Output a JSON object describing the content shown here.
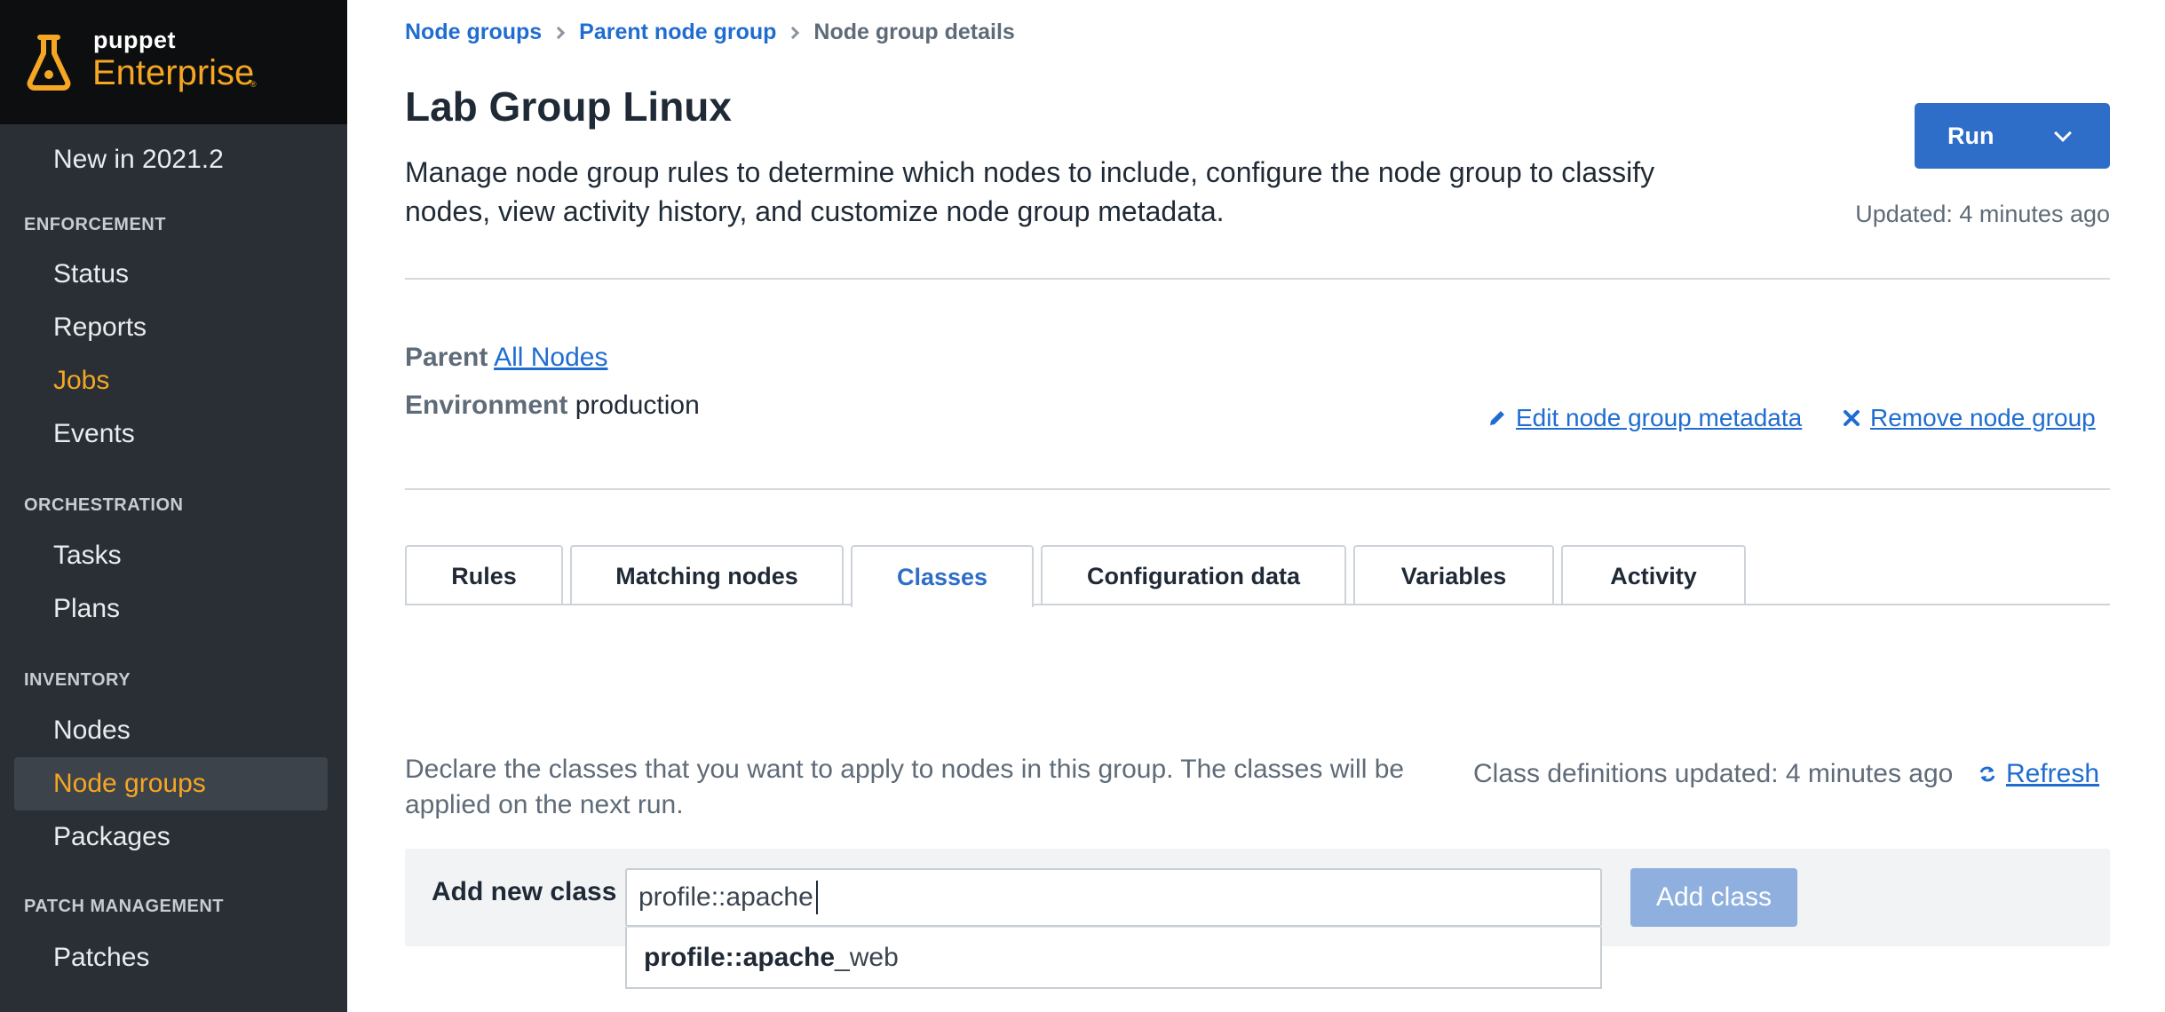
{
  "brand": {
    "small": "puppet",
    "big": "Enterprise",
    "reg": "®",
    "accent": "#f5a623"
  },
  "sidebar": {
    "new_in": "New in 2021.2",
    "sections": {
      "enforcement": "ENFORCEMENT",
      "orchestration": "ORCHESTRATION",
      "inventory": "INVENTORY",
      "patch": "PATCH MANAGEMENT"
    },
    "items": {
      "status": "Status",
      "reports": "Reports",
      "jobs": "Jobs",
      "events": "Events",
      "tasks": "Tasks",
      "plans": "Plans",
      "nodes": "Nodes",
      "node_groups": "Node groups",
      "packages": "Packages",
      "patches": "Patches"
    }
  },
  "breadcrumb": {
    "items": [
      "Node groups",
      "Parent node group"
    ],
    "current": "Node group details"
  },
  "header": {
    "title": "Lab Group Linux",
    "description": "Manage node group rules to determine which nodes to include, configure the node group to classify nodes, view activity history, and customize node group metadata.",
    "run_label": "Run",
    "updated": "Updated: 4 minutes ago"
  },
  "meta": {
    "parent_label": "Parent",
    "parent_value": "All Nodes",
    "environment_label": "Environment",
    "environment_value": "production",
    "edit_link": "Edit node group metadata",
    "remove_link": "Remove node group"
  },
  "tabs": [
    "Rules",
    "Matching nodes",
    "Classes",
    "Configuration data",
    "Variables",
    "Activity"
  ],
  "active_tab": "Classes",
  "classes": {
    "description": "Declare the classes that you want to apply to nodes in this group. The classes will be applied on the next run.",
    "definitions_updated": "Class definitions updated: 4 minutes ago",
    "refresh": "Refresh",
    "add_label": "Add new class",
    "input_value": "profile::apache",
    "add_button": "Add class",
    "suggestion_match": "profile::apache",
    "suggestion_rest": "_web"
  },
  "colors": {
    "link": "#1f6dd0",
    "primary": "#2e6dc8",
    "sidebar": "#2a2f36"
  }
}
